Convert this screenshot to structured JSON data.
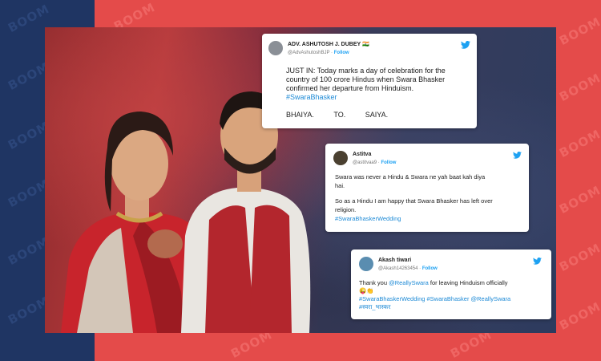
{
  "watermark": "BOOM",
  "tweets": [
    {
      "name": "ADV. ASHUTOSH J. DUBEY 🇮🇳",
      "handle": "@AdvAshutoshBJP",
      "follow": "Follow",
      "lines": [
        "JUST IN: Today marks a day of celebration for the",
        "country of 100 crore Hindus when Swara Bhasker",
        "confirmed her departure from Hinduism."
      ],
      "hashtag": "#SwaraBhasker",
      "tail": [
        "BHAIYA.",
        "TO.",
        "SAIYA."
      ]
    },
    {
      "name": "Astitva",
      "handle": "@astitvaa9",
      "follow": "Follow",
      "lines": [
        "Swara was never a Hindu & Swara ne yah baat kah diya",
        "hai.",
        "",
        "So as a Hindu I am happy that Swara Bhasker has left over",
        "religion."
      ],
      "hashtag": "#SwaraBhaskerWedding"
    },
    {
      "name": "Akash tiwari",
      "handle": "@Akash14263454",
      "follow": "Follow",
      "text_before": "Thank you ",
      "mention": "@ReallySwara",
      "text_after": " for leaving Hinduism officially",
      "emoji": "😜👏",
      "tags_line": "#SwaraBhaskerWedding #SwaraBhasker @ReallySwara",
      "tag_hindi": "#स्वरा_भास्कर"
    }
  ],
  "colors": {
    "navy": "#1f3563",
    "red": "#e44b4a",
    "link": "#1d8ad6",
    "twitter": "#1da1f2"
  }
}
